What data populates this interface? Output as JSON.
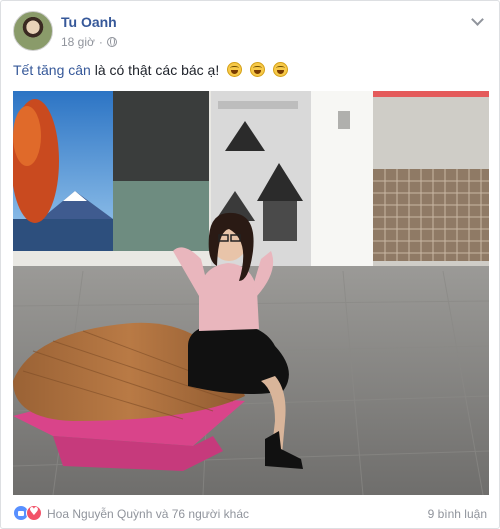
{
  "post": {
    "author": "Tu Oanh",
    "time": "18 giờ",
    "privacy_icon": "globe-icon",
    "options_icon": "chevron-down-icon",
    "caption": {
      "tag": "Tết tăng cân",
      "text": " là có thật các bác ạ!",
      "emojis": [
        "laughing-emoji-icon",
        "laughing-emoji-icon",
        "laughing-emoji-icon"
      ]
    },
    "photo": {
      "subject": "woman-sitting-on-bench"
    }
  },
  "footer": {
    "reactions": "Hoa Nguyễn Quỳnh và 76 người khác",
    "comments": "9 bình luận",
    "reaction_icons": [
      "like-icon",
      "love-icon"
    ]
  },
  "colors": {
    "link": "#365899",
    "meta": "#90949c",
    "like": "#5890ff",
    "love": "#f25268"
  }
}
